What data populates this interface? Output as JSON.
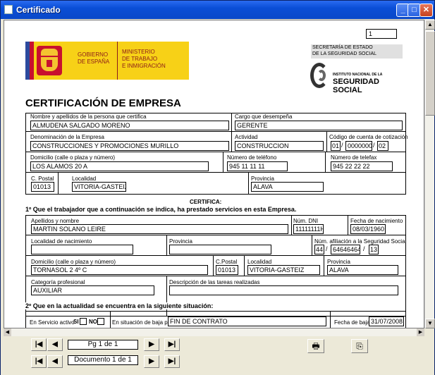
{
  "window": {
    "title": "Certificado"
  },
  "titlebar": {
    "min": "_",
    "max": "□",
    "close": "✕"
  },
  "doc": {
    "page_number_box": "1",
    "gov": {
      "line1": "GOBIERNO",
      "line2": "DE ESPAÑA",
      "ministry1": "MINISTERIO",
      "ministry2": "DE TRABAJO",
      "ministry3": "E INMIGRACIÓN"
    },
    "secretaria": {
      "line1": "SECRETARÍA DE ESTADO",
      "line2": "DE LA SEGURIDAD SOCIAL"
    },
    "ss_logo": {
      "small": "INSTITUTO NACIONAL DE LA",
      "big": "SEGURIDAD SOCIAL"
    },
    "title": "CERTIFICACIÓN DE EMPRESA",
    "company": {
      "certifier_name_label": "Nombre y apellidos de la persona que certifica",
      "certifier_name": "ALMUDENA SALGADO MORENO",
      "position_label": "Cargo que desempeña",
      "position": "GERENTE",
      "company_name_label": "Denominación de la Empresa",
      "company_name": "CONSTRUCCIONES Y PROMOCIONES MURILLO",
      "activity_label": "Actividad",
      "activity": "CONSTRUCCION",
      "ccc_label": "Código de cuenta de cotización",
      "ccc1": "01",
      "ccc2": "0000000",
      "ccc3": "02",
      "address_label": "Domicilio (calle o plaza y número)",
      "address": "LOS ALAMOS 20 A",
      "phone_label": "Número de teléfono",
      "phone": "945 11 11 11",
      "fax_label": "Número de telefax",
      "fax": "945 22 22 22",
      "postal_label": "C. Postal",
      "postal": "01013",
      "locality_label": "Localidad",
      "locality": "VITORIA-GASTEIZ",
      "province_label": "Provincia",
      "province": "ALAVA"
    },
    "certifica": "CERTIFICA:",
    "section1": "1º Que el trabajador que a continuación se indica, ha prestado servicios en esta Empresa.",
    "worker": {
      "name_label": "Apellidos y nombre",
      "name": "MARTIN SOLANO LEIRE",
      "dni_label": "Núm. DNI",
      "dni": "11111111H",
      "birth_label": "Fecha de nacimiento",
      "birth": "08/03/1960",
      "birth_locality_label": "Localidad de nacimiento",
      "birth_locality": "",
      "birth_province_label": "Provincia",
      "birth_province": "",
      "affiliation_label": "Núm. afiliación a la Seguridad Social",
      "aff1": "44",
      "aff2": "64646464",
      "aff3": "13",
      "address_label": "Domicilio (calle o plaza y número)",
      "address": "TORNASOL 2 4º C",
      "postal_label": "C.Postal",
      "postal": "01013",
      "locality_label": "Localidad",
      "locality": "VITORIA-GASTEIZ",
      "province_label": "Provincia",
      "province": "ALAVA",
      "category_label": "Categoría profesional",
      "category": "AUXILIAR",
      "tasks_label": "Descripción de las tareas realizadas",
      "tasks": ""
    },
    "section2": "2º Que en la actualidad se encuentra en la siguiente situación:",
    "status": {
      "active_label": "En Servicio activo",
      "si": "SI",
      "no": "NO",
      "baja_label": "En situación de baja por:",
      "baja_reason": "FIN DE CONTRATO",
      "baja_date_label": "Fecha de baja",
      "baja_date": "31/07/2008"
    }
  },
  "nav": {
    "page_text": "Pg 1 de 1",
    "doc_text": "Documento 1 de 1",
    "first": "|◀",
    "prev": "◀",
    "next": "▶",
    "last": "▶|"
  },
  "icons": {
    "print": "print-icon",
    "export": "export-icon"
  }
}
